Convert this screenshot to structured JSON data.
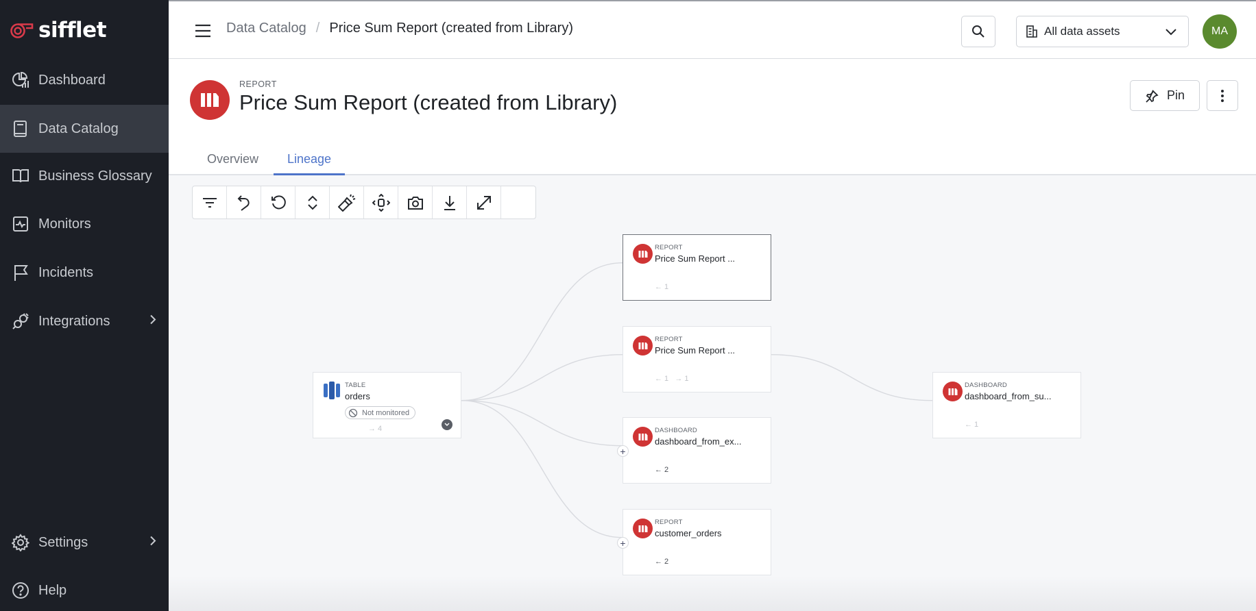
{
  "brand": {
    "name": "sifflet",
    "accent": "#d93a4a"
  },
  "sidebar": {
    "items": [
      {
        "label": "Dashboard",
        "icon": "dashboard-chart-icon"
      },
      {
        "label": "Data Catalog",
        "icon": "book-icon",
        "active": true
      },
      {
        "label": "Business Glossary",
        "icon": "open-book-icon"
      },
      {
        "label": "Monitors",
        "icon": "monitor-pulse-icon"
      },
      {
        "label": "Incidents",
        "icon": "flag-icon"
      },
      {
        "label": "Integrations",
        "icon": "plug-icon",
        "has_submenu": true
      },
      {
        "label": "Settings",
        "icon": "gear-icon",
        "has_submenu": true
      },
      {
        "label": "Help",
        "icon": "help-circle-icon"
      }
    ]
  },
  "header": {
    "breadcrumb": {
      "parent": "Data Catalog",
      "separator": "/",
      "current": "Price Sum Report (created from Library)"
    },
    "asset_filter": {
      "selected": "All data assets"
    },
    "avatar_initials": "MA"
  },
  "page": {
    "type_label": "REPORT",
    "title": "Price Sum Report (created from Library)",
    "pin_label": "Pin",
    "tabs": [
      {
        "label": "Overview",
        "active": false
      },
      {
        "label": "Lineage",
        "active": true
      }
    ]
  },
  "lineage": {
    "toolbar": [
      "filter",
      "undo",
      "reset",
      "collapse-expand",
      "highlight",
      "recenter",
      "screenshot",
      "download",
      "fullscreen",
      "empty"
    ],
    "nodes": [
      {
        "id": "orders",
        "type": "TABLE",
        "name": "orders",
        "badge": "Not monitored",
        "counts": "→ 4"
      },
      {
        "id": "r1",
        "type": "REPORT",
        "name": "Price Sum Report ...",
        "counts": "← 1",
        "selected": true
      },
      {
        "id": "r2",
        "type": "REPORT",
        "name": "Price Sum Report ...",
        "counts": "← 1   → 1"
      },
      {
        "id": "d1",
        "type": "DASHBOARD",
        "name": "dashboard_from_ex...",
        "counts": "← 2"
      },
      {
        "id": "r3",
        "type": "REPORT",
        "name": "customer_orders",
        "counts": "← 2"
      },
      {
        "id": "d2",
        "type": "DASHBOARD",
        "name": "dashboard_from_su...",
        "counts": "← 1"
      }
    ],
    "edges": [
      [
        "orders",
        "r1"
      ],
      [
        "orders",
        "r2"
      ],
      [
        "orders",
        "d1"
      ],
      [
        "orders",
        "r3"
      ],
      [
        "r2",
        "d2"
      ]
    ]
  }
}
